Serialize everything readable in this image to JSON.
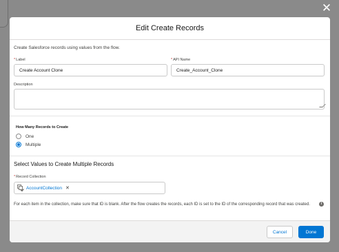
{
  "overlay": {
    "close_icon": "close-icon"
  },
  "modal": {
    "title": "Edit Create Records",
    "description": "Create Salesforce records using values from the flow.",
    "label_field": {
      "label": "Label",
      "value": "Create Account Clone"
    },
    "api_name_field": {
      "label": "API Name",
      "value": "Create_Account_Clone"
    },
    "description_field": {
      "label": "Description",
      "value": ""
    },
    "how_many": {
      "label": "How Many Records to Create",
      "options": [
        {
          "label": "One",
          "selected": false
        },
        {
          "label": "Multiple",
          "selected": true
        }
      ]
    },
    "select_values_heading": "Select Values to Create Multiple Records",
    "record_collection": {
      "label": "Record Collection",
      "pill_icon": "collection-variable-icon",
      "pill_label": "AccountCollection"
    },
    "help_text": "For each item in the collection, make sure that ID is blank. After the flow creates the records, each ID is set to the ID of the corresponding record that was created.",
    "footer": {
      "cancel_label": "Cancel",
      "done_label": "Done"
    }
  },
  "colors": {
    "brand": "#0176d3",
    "required": "#c23934",
    "backdrop": "#8a8a8a"
  }
}
